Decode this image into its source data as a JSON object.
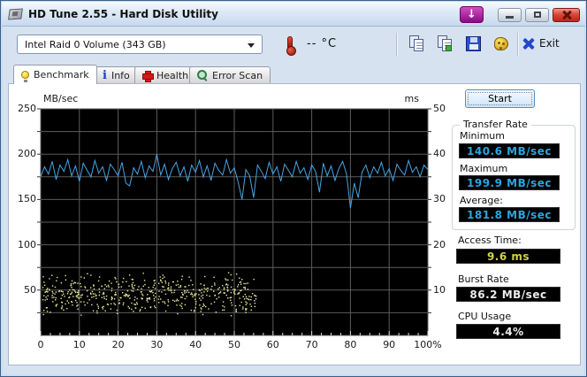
{
  "window": {
    "title": "HD Tune 2.55 - Hard Disk Utility"
  },
  "toolbar": {
    "drive_select": "Intel   Raid 0 Volume (343 GB)",
    "temperature": "-- °C",
    "exit_label": "Exit",
    "icons": [
      "copy-icon",
      "copy-image-icon",
      "save-icon",
      "options-icon"
    ]
  },
  "tabs": [
    {
      "label": "Benchmark",
      "icon": "bulb-icon",
      "active": true
    },
    {
      "label": "Info",
      "icon": "info-icon",
      "active": false
    },
    {
      "label": "Health",
      "icon": "health-cross-icon",
      "active": false
    },
    {
      "label": "Error Scan",
      "icon": "magnifier-icon",
      "active": false
    }
  ],
  "results": {
    "start_label": "Start",
    "transfer_rate_group": "Transfer Rate",
    "minimum_label": "Minimum",
    "minimum_value": "140.6 MB/sec",
    "maximum_label": "Maximum",
    "maximum_value": "199.9 MB/sec",
    "average_label": "Average:",
    "average_value": "181.8 MB/sec",
    "access_time_label": "Access Time:",
    "access_time_value": "9.6 ms",
    "burst_rate_label": "Burst Rate",
    "burst_rate_value": "86.2 MB/sec",
    "cpu_usage_label": "CPU Usage",
    "cpu_usage_value": "4.4%"
  },
  "colors": {
    "transfer_line": "#45a6e6",
    "access_dots": "#e9e99c",
    "plot_bg": "#000000",
    "grid": "#5c5c5c",
    "value_cyan": "#2aa6de",
    "value_yellow": "#d0d050",
    "value_white": "#ececec",
    "window_bg": "#d6e2f0"
  },
  "chart_data": {
    "type": "line",
    "title": "",
    "left_axis": {
      "label": "MB/sec",
      "min": 0,
      "max": 250,
      "ticks": [
        250,
        200,
        150,
        100,
        50
      ]
    },
    "right_axis": {
      "label": "ms",
      "min": 0,
      "max": 50,
      "ticks": [
        50,
        40,
        30,
        20,
        10
      ]
    },
    "x_axis": {
      "min": 0,
      "max": 100,
      "labels": [
        "0",
        "10",
        "20",
        "30",
        "40",
        "50",
        "60",
        "70",
        "80",
        "90",
        "100%"
      ]
    },
    "grid": {
      "x_interval": 10,
      "y_interval": 25
    },
    "series": [
      {
        "name": "transfer-rate",
        "type": "line",
        "unit": "MB/sec",
        "axis": "left",
        "summary": {
          "minimum": 140.6,
          "maximum": 199.9,
          "average": 181.8
        },
        "values": [
          175,
          186,
          178,
          192,
          172,
          188,
          181,
          194,
          176,
          187,
          170,
          190,
          182,
          175,
          193,
          179,
          186,
          171,
          189,
          183,
          176,
          191,
          168,
          165,
          185,
          178,
          192,
          174,
          187,
          181,
          199.9,
          177,
          189,
          172,
          184,
          191,
          176,
          186,
          170,
          188,
          180,
          193,
          175,
          187,
          171,
          190,
          182,
          177,
          194,
          179,
          185,
          169,
          150,
          183,
          176,
          152,
          188,
          181,
          173,
          191,
          178,
          186,
          170,
          189,
          182,
          175,
          192,
          179,
          185,
          172,
          188,
          181,
          158,
          190,
          176,
          187,
          171,
          184,
          192,
          178,
          140.6,
          168,
          152,
          180,
          188,
          174,
          186,
          179,
          191,
          176,
          184,
          171,
          189,
          182,
          177,
          193,
          180,
          186,
          175,
          188,
          183
        ]
      },
      {
        "name": "access-time",
        "type": "scatter",
        "unit": "ms",
        "axis": "right",
        "summary": {
          "average": 9.6
        },
        "generate": {
          "count": 540,
          "seed": 11,
          "x_min": 0.3,
          "x_max": 55.5,
          "ms_mean": 9.3,
          "ms_spread": 3.3,
          "ms_min": 3.0,
          "ms_max": 14.5
        }
      }
    ]
  }
}
